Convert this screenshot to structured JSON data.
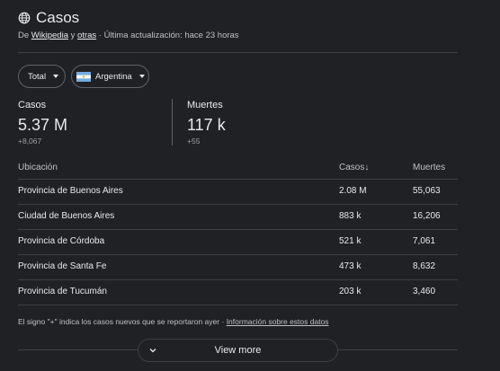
{
  "header": {
    "title": "Casos",
    "source_prefix": "De",
    "source_link_1": "Wikipedia",
    "source_conj": "y",
    "source_link_2": "otras",
    "source_updated": "· Última actualización: hace 23 horas"
  },
  "filters": {
    "total_label": "Total",
    "region_label": "Argentina"
  },
  "stats": {
    "cases_label": "Casos",
    "cases_value": "5.37 M",
    "cases_delta": "+8,067",
    "deaths_label": "Muertes",
    "deaths_value": "117 k",
    "deaths_delta": "+55"
  },
  "table": {
    "headers": {
      "location": "Ubicación",
      "cases": "Casos",
      "cases_sort_icon": "↓",
      "deaths": "Muertes"
    },
    "rows": [
      {
        "location": "Provincia de Buenos Aires",
        "cases": "2.08 M",
        "deaths": "55,063"
      },
      {
        "location": "Ciudad de Buenos Aires",
        "cases": "883 k",
        "deaths": "16,206"
      },
      {
        "location": "Provincia de Córdoba",
        "cases": "521 k",
        "deaths": "7,061"
      },
      {
        "location": "Provincia de Santa Fe",
        "cases": "473 k",
        "deaths": "8,632"
      },
      {
        "location": "Provincia de Tucumán",
        "cases": "203 k",
        "deaths": "3,460"
      }
    ]
  },
  "footer": {
    "note": "El signo \"+\" indica los casos nuevos que se reportaron ayer",
    "separator": "·",
    "info_link": "Información sobre estos datos",
    "view_more": "View more"
  },
  "icons": {
    "title_icon": "globe-icon",
    "dropdown_icon": "caret-down-icon",
    "flag_icon": "argentina-flag-icon",
    "expand_icon": "chevron-down-icon"
  },
  "colors": {
    "background": "#202124",
    "text": "#e8eaed",
    "muted": "#9aa0a6",
    "divider": "#3c4043",
    "flag_blue": "#74acdf",
    "flag_white": "#ffffff",
    "flag_sun": "#f6b40e"
  }
}
